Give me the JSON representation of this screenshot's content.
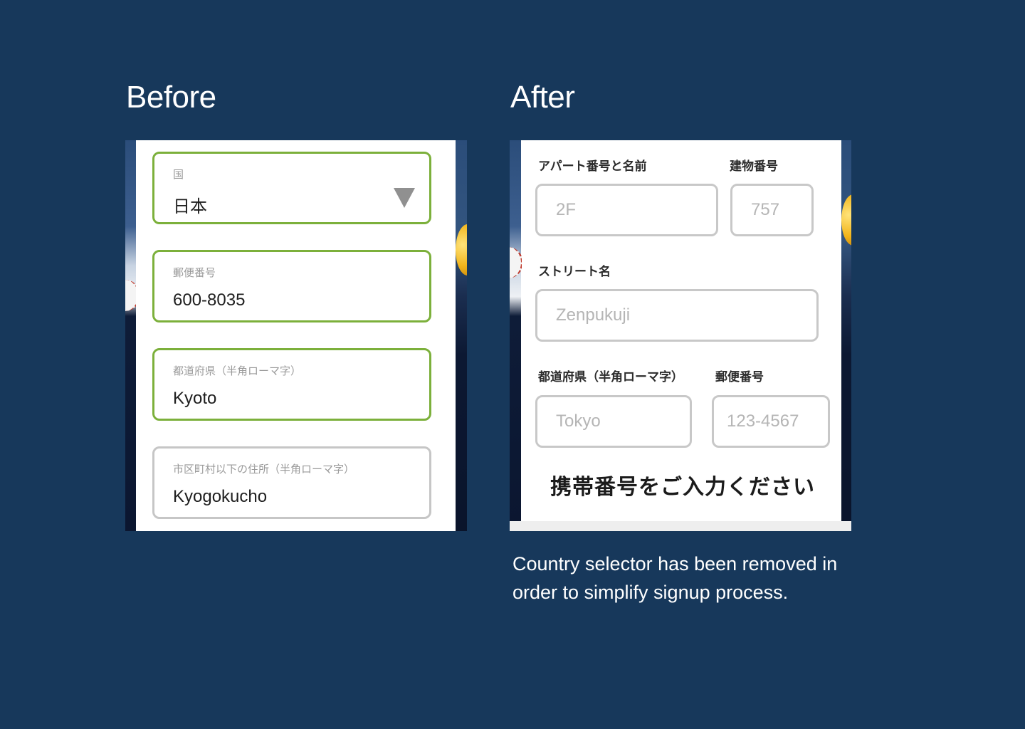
{
  "headings": {
    "before": "Before",
    "after": "After"
  },
  "before_form": {
    "country": {
      "label": "国",
      "value": "日本"
    },
    "postal": {
      "label": "郵便番号",
      "value": "600-8035"
    },
    "prefecture": {
      "label": "都道府県（半角ローマ字）",
      "value": "Kyoto"
    },
    "city": {
      "label": "市区町村以下の住所（半角ローマ字）",
      "value": "Kyogokucho"
    }
  },
  "after_form": {
    "apartment": {
      "label": "アパート番号と名前",
      "placeholder": "2F"
    },
    "building": {
      "label": "建物番号",
      "placeholder": "757"
    },
    "street": {
      "label": "ストリート名",
      "placeholder": "Zenpukuji"
    },
    "prefecture": {
      "label": "都道府県（半角ローマ字）",
      "placeholder": "Tokyo"
    },
    "postal": {
      "label": "郵便番号",
      "placeholder": "123-4567"
    },
    "phone_heading": "携帯番号をご入力ください"
  },
  "caption": "Country selector has been removed in order to simplify signup process.",
  "colors": {
    "background": "#17385b",
    "active_border": "#7cb03b",
    "inactive_border": "#c6c6c6"
  }
}
